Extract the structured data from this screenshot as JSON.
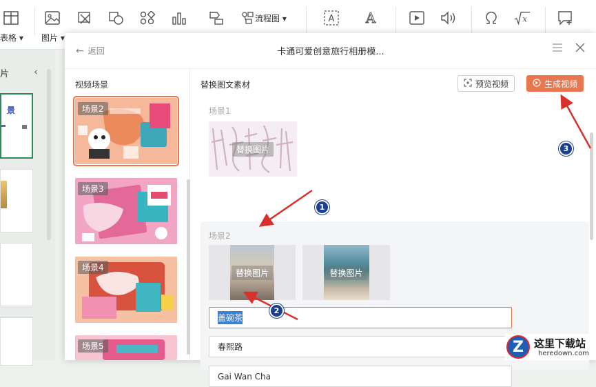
{
  "toolbar": {
    "table_label": "表格",
    "picture_label": "图片",
    "flowchart_label": "流程图",
    "icons": [
      "table-icon",
      "picture-icon",
      "screenshot-icon",
      "shape-icon",
      "icons-library-icon",
      "chart-icon",
      "smartart-icon",
      "flowchart-icon",
      "textbox-icon",
      "wordart-icon",
      "video-icon",
      "audio-icon",
      "symbol-icon",
      "formula-icon",
      "comment-icon"
    ]
  },
  "leftbar": {
    "header_fragment": "片",
    "slide_title_fragment": "景",
    "collapse_glyph": "‹"
  },
  "modal": {
    "back_label": "返回",
    "title": "卡通可爱创意旅行相册模...",
    "scenes_heading": "视频场景",
    "scenes": [
      {
        "label": "场景2",
        "selected": true
      },
      {
        "label": "场景3",
        "selected": false
      },
      {
        "label": "场景4",
        "selected": false
      },
      {
        "label": "场景5",
        "selected": false
      }
    ],
    "materials_heading": "替换图文素材",
    "preview_label": "预览视频",
    "generate_label": "生成视频",
    "accent_color": "#e8764f",
    "scene1": {
      "label": "场景1",
      "replace_label": "替换图片"
    },
    "scene2": {
      "label": "场景2",
      "images": [
        {
          "replace_label": "替换图片"
        },
        {
          "replace_label": "替换图片"
        }
      ],
      "fields": [
        {
          "value": "盖碗茶",
          "selected": true
        },
        {
          "value": "春熙路",
          "selected": false
        },
        {
          "value": "Gai Wan Cha",
          "selected": false
        }
      ]
    }
  },
  "annotations": {
    "callouts": [
      "1",
      "2",
      "3"
    ]
  },
  "watermark": {
    "text": "这里下载站",
    "url_text": "heredown.com",
    "logo_letter": "Z"
  }
}
